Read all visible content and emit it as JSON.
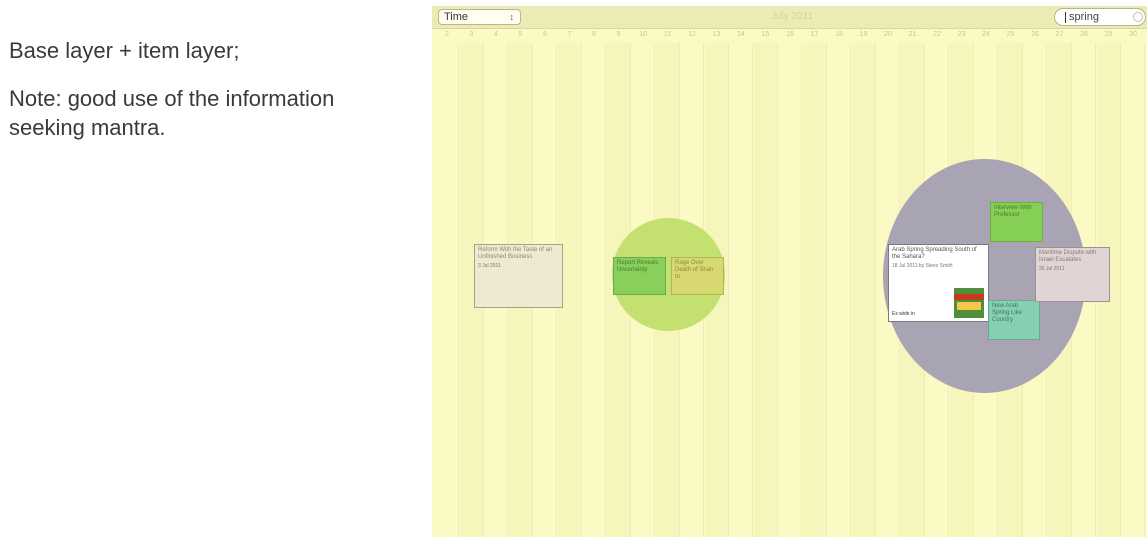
{
  "notes": {
    "line1": "Base layer + item layer;",
    "line2": "Note: good use of the information seeking mantra."
  },
  "app": {
    "view_select": {
      "value": "Time",
      "arrows_icon": "up-down-arrows-icon"
    },
    "month_title": "July 2011",
    "search": {
      "value": "spring",
      "icon": "clear-search-icon"
    },
    "days": [
      "2",
      "3",
      "4",
      "5",
      "6",
      "7",
      "8",
      "9",
      "10",
      "11",
      "12",
      "13",
      "14",
      "15",
      "16",
      "17",
      "18",
      "19",
      "20",
      "21",
      "22",
      "23",
      "24",
      "25",
      "26",
      "27",
      "28",
      "29",
      "30"
    ],
    "colors": {
      "background": "#fbfac4",
      "green_cluster": "#c4e070",
      "gray_cluster": "#a9a4b3"
    },
    "cards": {
      "beige": {
        "title": "Reform With the Taste of an Unfinished Business",
        "meta": "3 Jul 2011"
      },
      "green_small": {
        "title": "Report Reveals Uncertainty"
      },
      "yellow": {
        "title": "Rage Over Death of Shan to"
      },
      "white": {
        "title": "Arab Spring Spreading South of the Sahara?",
        "meta": "18 Jul 2011 by Steve Smith",
        "readmore": "Ex wide in"
      },
      "green_top": {
        "title": "Interview With Professor"
      },
      "teal": {
        "title": "New Arab Spring Like Country"
      },
      "mauve": {
        "title": "Maritime Dispute with Israel Escalates",
        "meta": "26 Jul 2011"
      }
    }
  }
}
